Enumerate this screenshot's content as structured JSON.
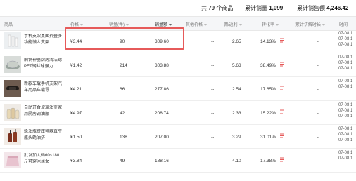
{
  "summary": {
    "total_label": "共",
    "total_count": "79",
    "total_unit": "个商品",
    "sales_label": "累计销量",
    "sales_value": "1,099",
    "amount_label": "累计销售额",
    "amount_value": "4,246.42"
  },
  "columns": {
    "product": "商品",
    "price": "价格",
    "quantity": "销量(件)",
    "amount": "销量额",
    "other_price": "其他价格",
    "commission": "佣/返利",
    "conversion": "转化率",
    "cumulative": "累计讲解时长",
    "time": "时间"
  },
  "colors": {
    "highlight": "#e65a5a",
    "trend": "#e65a5a"
  },
  "rows": [
    {
      "name": "手机支架桌面折叠多功能懒人支架",
      "price": "¥3.44",
      "quantity": "90",
      "amount": "309.60",
      "other": "--",
      "commission": "2.65",
      "conversion": "14.13%",
      "dates": [
        "07-08 1",
        "07-08 1",
        "07-08 1"
      ],
      "thumb": "stand"
    },
    {
      "name": "刷锅神器厨房清洁球PET钢丝球强力",
      "price": "¥1.42",
      "quantity": "214",
      "amount": "303.88",
      "other": "--",
      "commission": "5.63",
      "conversion": "38.49%",
      "dates": [
        "07-08 1",
        "07-08 1",
        "07-08 1"
      ],
      "thumb": "sponge"
    },
    {
      "name": "新款车载手机支架汽车用品车载导",
      "price": "¥4.21",
      "quantity": "66",
      "amount": "277.86",
      "other": "--",
      "commission": "2.54",
      "conversion": "17.65%",
      "dates": [
        "07-08 1",
        "07-08 1"
      ],
      "thumb": "car"
    },
    {
      "name": "自动开合玻璃油壶家用厨房调油瓶",
      "price": "¥4.97",
      "quantity": "42",
      "amount": "208.74",
      "other": "--",
      "commission": "2.33",
      "conversion": "15.22%",
      "dates": [
        "07-08 1",
        "07-08 1",
        "07-08 1"
      ],
      "thumb": "bottle"
    },
    {
      "name": "蚝油瓶挤压神器真空瓶头蚝油挤",
      "price": "¥1.50",
      "quantity": "138",
      "amount": "207.00",
      "other": "--",
      "commission": "3.29",
      "conversion": "31.01%",
      "dates": [
        "07-08 1",
        "07-08 1",
        "07-08 1"
      ],
      "thumb": "pump"
    },
    {
      "name": "批发加大码60~180斤可穿冰丝女",
      "price": "¥3.84",
      "quantity": "49",
      "amount": "188.16",
      "other": "--",
      "commission": "4.10",
      "conversion": "17.38%",
      "dates": [
        "07-08 1",
        "07-08 1"
      ],
      "thumb": "cloth"
    }
  ]
}
